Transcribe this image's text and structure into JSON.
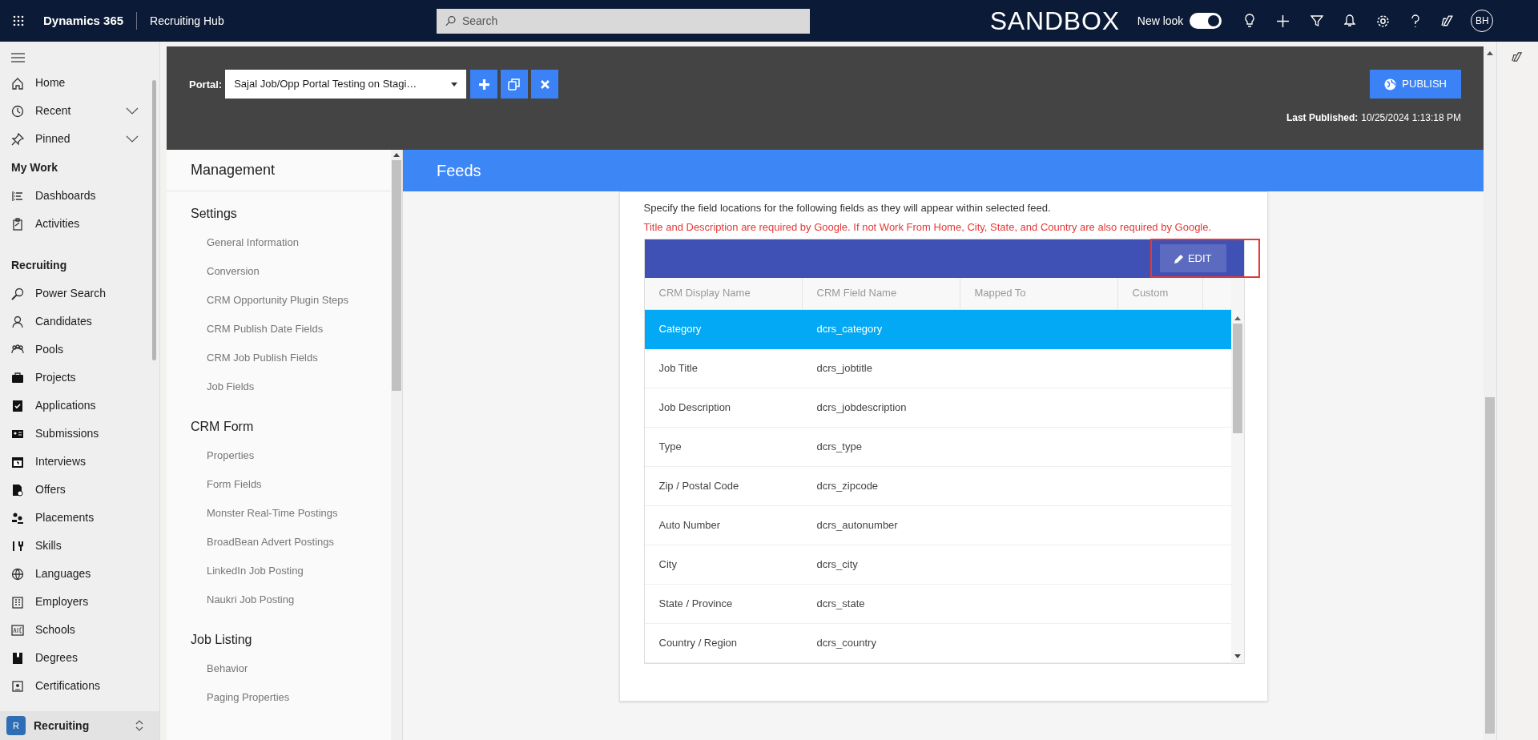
{
  "top_bar": {
    "app_name": "Dynamics 365",
    "area_name": "Recruiting Hub",
    "search_placeholder": "Search",
    "environment": "SANDBOX",
    "new_look": {
      "label": "New look",
      "on": true
    },
    "avatar": "BH"
  },
  "nav": {
    "sections": [
      {
        "items": [
          {
            "label": "Home",
            "has_menu": false
          },
          {
            "label": "Recent",
            "has_menu": true
          },
          {
            "label": "Pinned",
            "has_menu": true
          }
        ]
      },
      {
        "title": "My Work",
        "items": [
          {
            "label": "Dashboards",
            "has_menu": false
          },
          {
            "label": "Activities",
            "has_menu": false
          }
        ]
      },
      {
        "title": "Recruiting",
        "items": [
          {
            "label": "Power Search",
            "has_menu": false
          },
          {
            "label": "Candidates",
            "has_menu": false
          },
          {
            "label": "Pools",
            "has_menu": false
          },
          {
            "label": "Projects",
            "has_menu": false
          },
          {
            "label": "Applications",
            "has_menu": false
          },
          {
            "label": "Submissions",
            "has_menu": false
          },
          {
            "label": "Interviews",
            "has_menu": false
          },
          {
            "label": "Offers",
            "has_menu": false
          },
          {
            "label": "Placements",
            "has_menu": false
          },
          {
            "label": "Skills",
            "has_menu": false
          },
          {
            "label": "Languages",
            "has_menu": false
          },
          {
            "label": "Employers",
            "has_menu": false
          },
          {
            "label": "Schools",
            "has_menu": false
          },
          {
            "label": "Degrees",
            "has_menu": false
          },
          {
            "label": "Certifications",
            "has_menu": false
          }
        ]
      }
    ]
  },
  "area_switcher": {
    "badge": "R",
    "label": "Recruiting"
  },
  "portal": {
    "label": "Portal:",
    "selected": "Sajal Job/Opp Portal Testing on Stagi…",
    "publish_button": "PUBLISH",
    "last_published_label": "Last Published:",
    "last_published_value": "10/25/2024 1:13:18 PM"
  },
  "management": {
    "title": "Management",
    "sections": [
      {
        "title": "Settings",
        "items": [
          "General Information",
          "Conversion",
          "CRM Opportunity Plugin Steps",
          "CRM Publish Date Fields",
          "CRM Job Publish Fields",
          "Job Fields"
        ]
      },
      {
        "title": "CRM Form",
        "items": [
          "Properties",
          "Form Fields",
          "Monster Real-Time Postings",
          "BroadBean Advert Postings",
          "LinkedIn Job Posting",
          "Naukri Job Posting"
        ]
      },
      {
        "title": "Job Listing",
        "items": [
          "Behavior",
          "Paging Properties"
        ]
      }
    ]
  },
  "feeds": {
    "title": "Feeds",
    "instructions": "Specify the field locations for the following fields as they will appear within selected feed.",
    "warning": "Title and Description are required by Google. If not Work From Home, City, State, and Country are also required by Google.",
    "edit_button": "EDIT",
    "columns": [
      "CRM Display Name",
      "CRM Field Name",
      "Mapped To",
      "Custom"
    ],
    "rows": [
      {
        "display_name": "Category",
        "field_name": "dcrs_category",
        "selected": true
      },
      {
        "display_name": "Job Title",
        "field_name": "dcrs_jobtitle",
        "selected": false
      },
      {
        "display_name": "Job Description",
        "field_name": "dcrs_jobdescription",
        "selected": false
      },
      {
        "display_name": "Type",
        "field_name": "dcrs_type",
        "selected": false
      },
      {
        "display_name": "Zip / Postal Code",
        "field_name": "dcrs_zipcode",
        "selected": false
      },
      {
        "display_name": "Auto Number",
        "field_name": "dcrs_autonumber",
        "selected": false
      },
      {
        "display_name": "City",
        "field_name": "dcrs_city",
        "selected": false
      },
      {
        "display_name": "State / Province",
        "field_name": "dcrs_state",
        "selected": false
      },
      {
        "display_name": "Country / Region",
        "field_name": "dcrs_country",
        "selected": false
      }
    ]
  }
}
